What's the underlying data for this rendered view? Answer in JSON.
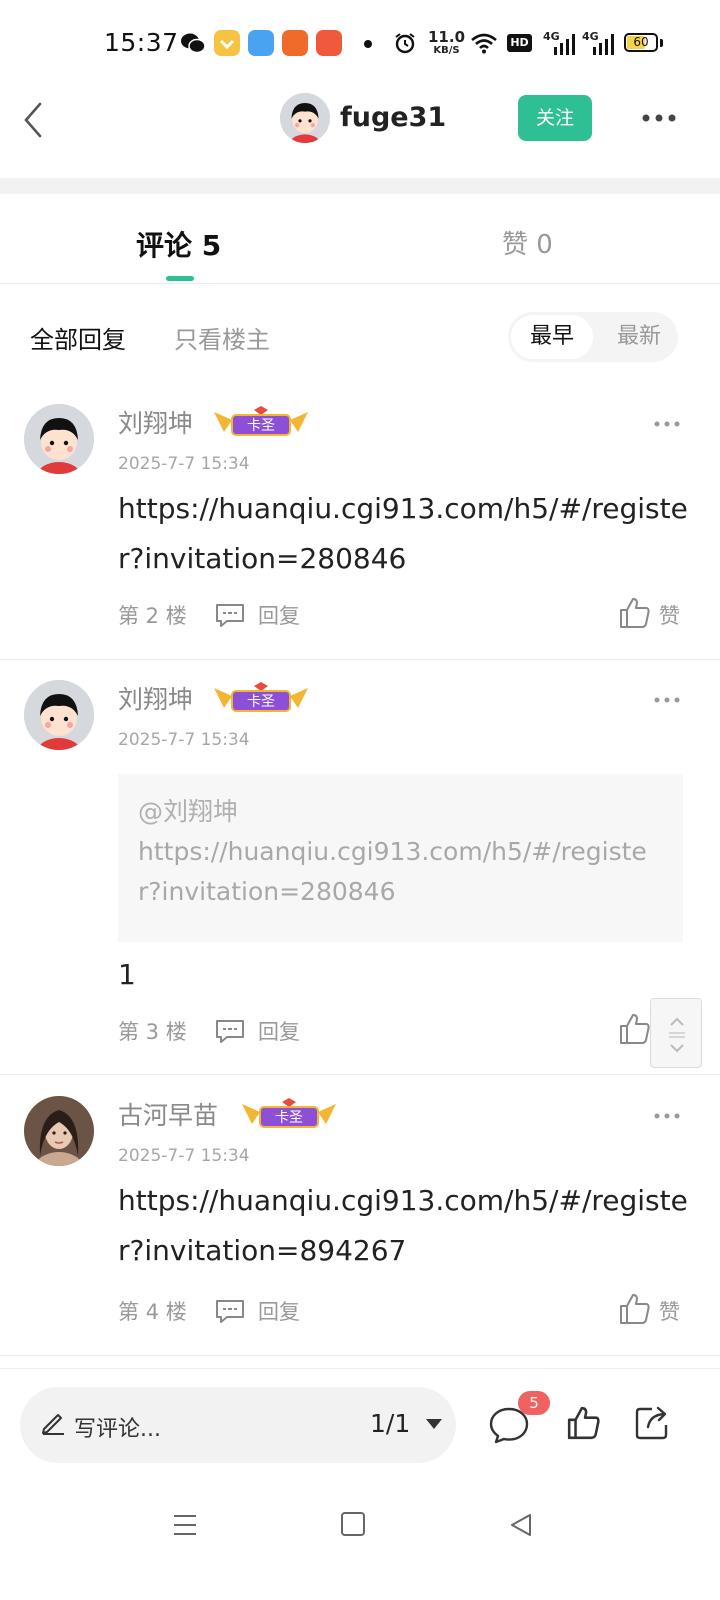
{
  "status_bar": {
    "time": "15:37",
    "net_speed_value": "11.0",
    "net_speed_unit": "KB/S",
    "hd_label": "HD",
    "signal1_label": "4G",
    "signal2_label": "4G",
    "battery_level": "60",
    "app_icons": [
      "wechat-icon",
      "taobao-icon",
      "browser-icon",
      "app-icon",
      "app-icon"
    ]
  },
  "header": {
    "username": "fuge31",
    "follow_label": "关注"
  },
  "tabs": {
    "comments_label": "评论 5",
    "likes_label": "赞 0"
  },
  "filters": {
    "all_label": "全部回复",
    "owner_only_label": "只看楼主",
    "sort_earliest": "最早",
    "sort_latest": "最新"
  },
  "badge_label": "卡圣",
  "comments": [
    {
      "author": "刘翔坤",
      "date": "2025-7-7 15:34",
      "content": "https://huanqiu.cgi913.com/h5/#/register?invitation=280846",
      "floor": "第 2 楼",
      "reply_label": "回复",
      "like_label": "赞"
    },
    {
      "author": "刘翔坤",
      "date": "2025-7-7 15:34",
      "quote_at": "@刘翔坤",
      "quote_text": "https://huanqiu.cgi913.com/h5/#/register?invitation=280846",
      "content": "1",
      "floor": "第 3 楼",
      "reply_label": "回复",
      "like_label": "赞"
    },
    {
      "author": "古河早苗",
      "date": "2025-7-7 15:34",
      "content": "https://huanqiu.cgi913.com/h5/#/register?invitation=894267",
      "floor": "第 4 楼",
      "reply_label": "回复",
      "like_label": "赞"
    }
  ],
  "bottom_bar": {
    "compose_placeholder": "写评论...",
    "page_indicator": "1/1",
    "comment_count": "5"
  },
  "colors": {
    "accent": "#2fbf95",
    "badge_red": "#f06262",
    "badge_purple": "#8c4fd6"
  }
}
